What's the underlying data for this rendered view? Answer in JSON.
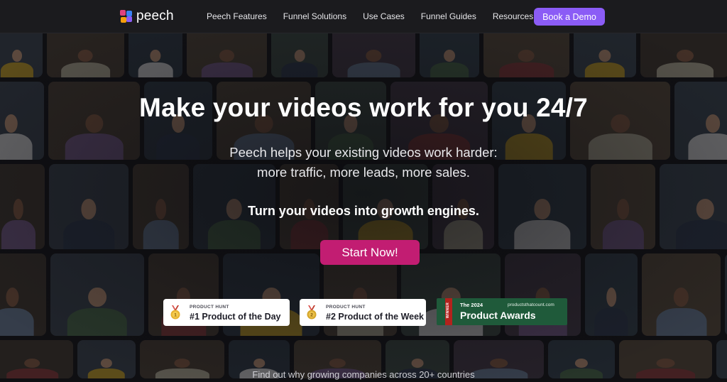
{
  "nav": {
    "logo_text": "peech",
    "logo_colors": [
      "#e0427f",
      "#3b82f6",
      "#f59e0b",
      "#8b5cf6"
    ],
    "links": [
      "Peech Features",
      "Funnel Solutions",
      "Use Cases",
      "Funnel Guides",
      "Resources"
    ],
    "demo_label": "Book a Demo",
    "demo_color": "#8b5cf6"
  },
  "hero": {
    "headline": "Make your videos work for you 24/7",
    "sub_line_1": "Peech helps your existing videos work harder:",
    "sub_line_2": "more traffic, more leads, more sales.",
    "tagline": "Turn your videos into growth engines.",
    "cta_label": "Start Now!",
    "cta_color": "#c21d72"
  },
  "badges": [
    {
      "kicker": "PRODUCT HUNT",
      "title": "#1 Product of the Day",
      "medal": "gold-medal-icon"
    },
    {
      "kicker": "PRODUCT HUNT",
      "title": "#2 Product of the Week",
      "medal": "silver-medal-icon"
    }
  ],
  "award": {
    "ribbon": "WINNER",
    "year": "The 2024",
    "site": "productsthatcount.com",
    "name": "Product Awards",
    "color": "#1f5a3a"
  },
  "footer_text": "Find out why growing companies across 20+ countries"
}
